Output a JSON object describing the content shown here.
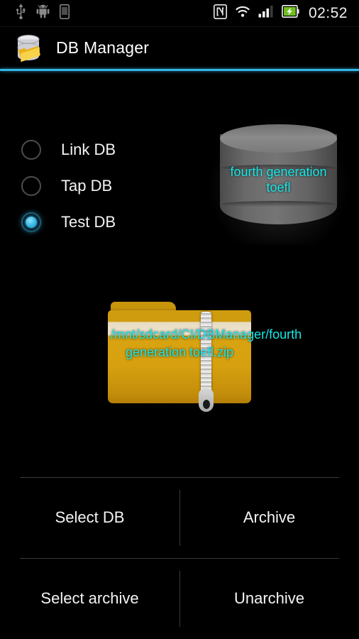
{
  "status_bar": {
    "left_icons": [
      "usb-icon",
      "android-robot-icon",
      "sd-storage-icon"
    ],
    "right_icons": [
      "nfc-icon",
      "wifi-icon",
      "signal-icon",
      "battery-charging-icon"
    ],
    "clock": "02:52"
  },
  "action_bar": {
    "app_icon": "db-folder-icon",
    "title": "DB Manager",
    "accent_color": "#33b5e5"
  },
  "radio_group": {
    "selected_index": 2,
    "options": [
      {
        "label": "Link DB",
        "selected": false
      },
      {
        "label": "Tap DB",
        "selected": false
      },
      {
        "label": "Test DB",
        "selected": true
      }
    ]
  },
  "database": {
    "icon": "database-cylinder-icon",
    "label": "fourth generation toefl",
    "label_color": "#17e8e8"
  },
  "archive": {
    "icon": "zip-folder-icon",
    "label": "/mnt/sdcard/CI/DBManager/fourth generation toefl.zip",
    "label_color": "#17e8e8"
  },
  "buttons": [
    {
      "label": "Select DB"
    },
    {
      "label": "Archive"
    },
    {
      "label": "Select archive"
    },
    {
      "label": "Unarchive"
    }
  ]
}
